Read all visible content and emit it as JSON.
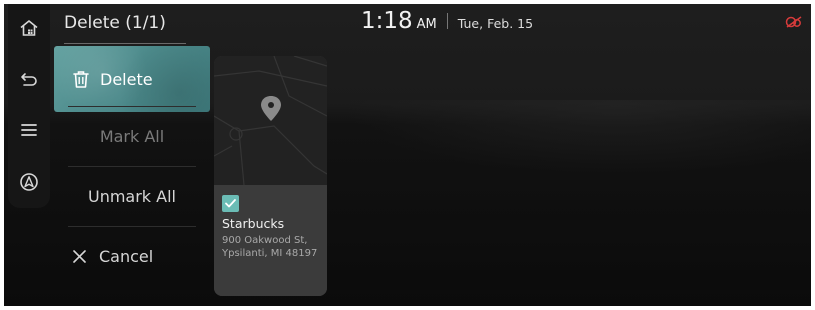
{
  "header": {
    "title": "Delete (1/1)"
  },
  "clock": {
    "time": "1:18",
    "ampm": "AM",
    "date": "Tue, Feb. 15"
  },
  "rail": {
    "icons": [
      "home-icon",
      "back-icon",
      "menu-icon",
      "navigation-icon"
    ]
  },
  "menu": {
    "delete_label": "Delete",
    "mark_all_label": "Mark All",
    "unmark_all_label": "Unmark All",
    "cancel_label": "Cancel"
  },
  "card": {
    "checked": true,
    "name": "Starbucks",
    "address_line1": "900 Oakwood St,",
    "address_line2": "Ypsilanti, MI 48197"
  },
  "colors": {
    "accent": "#4d8b8c",
    "checkbox": "#6bbcb5",
    "status_icon": "#d63b3b"
  }
}
